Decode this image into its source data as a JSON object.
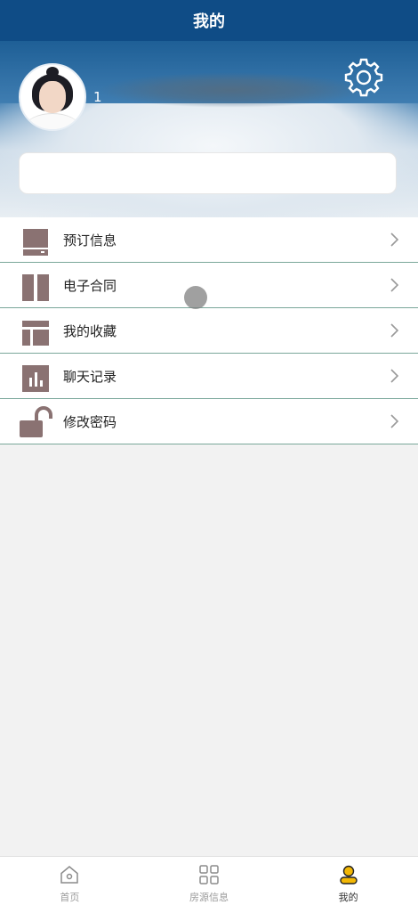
{
  "header": {
    "title": "我的"
  },
  "profile": {
    "username": "1",
    "search_value": ""
  },
  "menu": {
    "items": [
      {
        "label": "预订信息",
        "icon": "reservation-icon"
      },
      {
        "label": "电子合同",
        "icon": "contract-icon"
      },
      {
        "label": "我的收藏",
        "icon": "favorites-icon"
      },
      {
        "label": "聊天记录",
        "icon": "chat-history-icon"
      },
      {
        "label": "修改密码",
        "icon": "unlock-icon"
      }
    ]
  },
  "tabbar": {
    "tabs": [
      {
        "label": "首页",
        "icon": "home-icon"
      },
      {
        "label": "房源信息",
        "icon": "grid-icon"
      },
      {
        "label": "我的",
        "icon": "user-icon",
        "active": true
      }
    ]
  },
  "colors": {
    "nav": "#0f4c86",
    "icon": "#8a7272",
    "divider": "#7aa79a",
    "active_tab_icon": "#e0a100"
  }
}
